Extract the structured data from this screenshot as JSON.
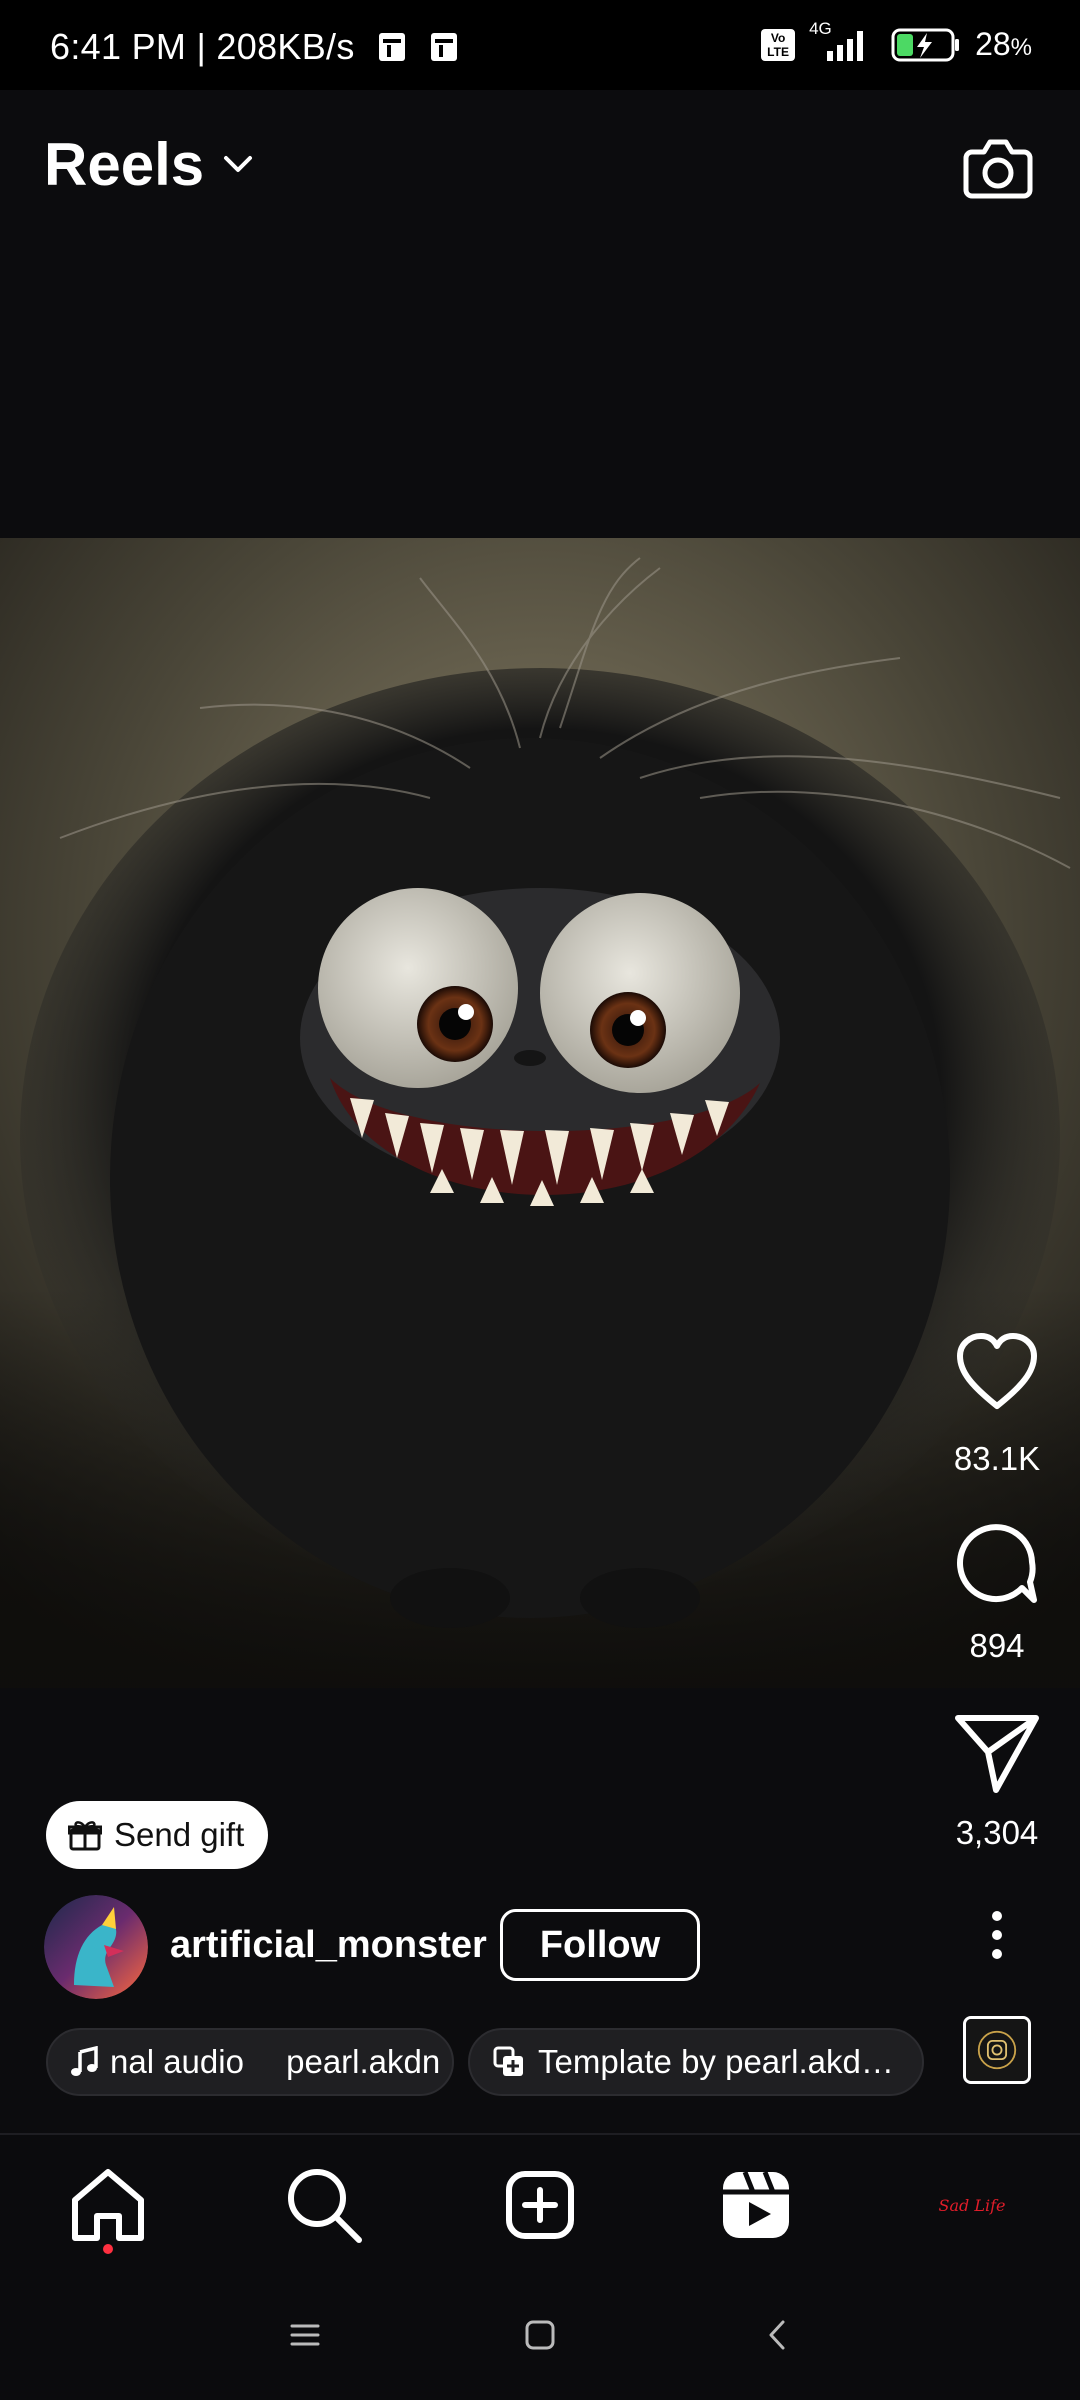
{
  "status_bar": {
    "time_speed": "6:41 PM | 208KB/s",
    "network": "4G",
    "volte": "Vo LTE",
    "battery": "28",
    "battery_unit": "%"
  },
  "header": {
    "title": "Reels"
  },
  "actions": {
    "likes": "83.1K",
    "comments": "894",
    "shares": "3,304"
  },
  "gift": {
    "label": "Send gift"
  },
  "author": {
    "username": "artificial_monster",
    "follow_label": "Follow"
  },
  "audio": {
    "label": "nal audio  pearl.akdn",
    "template_label": "Template by pearl.akd…"
  },
  "nav": {
    "profile_label": "Sad Life"
  },
  "colors": {
    "background": "#0c0c0e",
    "accent_dot": "#ff3040",
    "battery_green": "#4cd964"
  },
  "icons": [
    "camera-icon",
    "chevron-down-icon",
    "heart-icon",
    "comment-icon",
    "send-icon",
    "gift-icon",
    "more-icon",
    "music-note-icon",
    "template-icon",
    "home-icon",
    "search-icon",
    "create-icon",
    "reels-icon"
  ]
}
